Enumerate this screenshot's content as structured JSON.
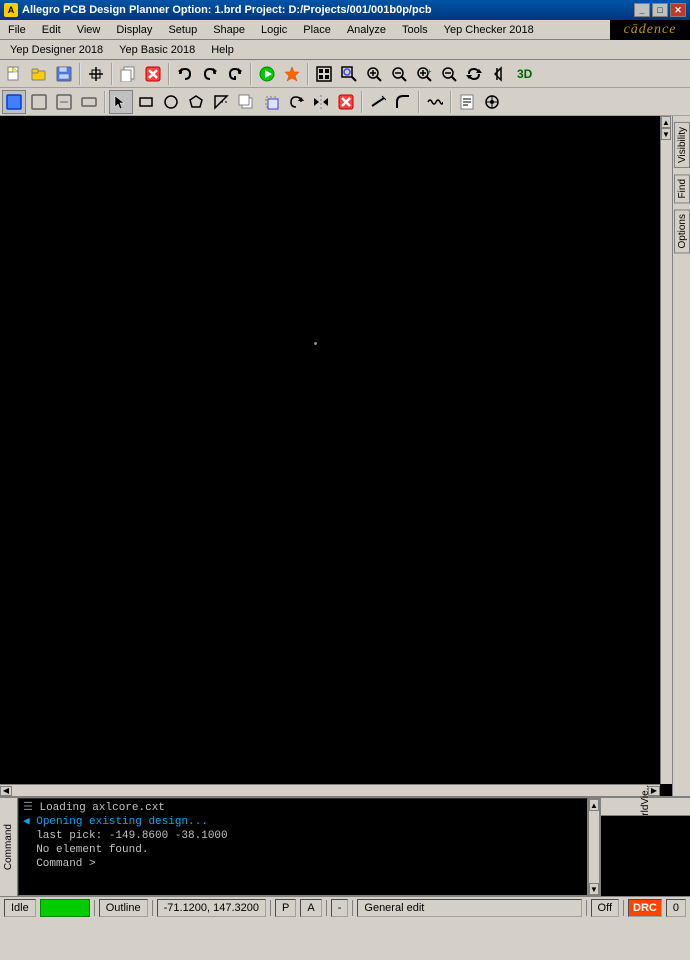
{
  "titlebar": {
    "title": "Allegro PCB Design Planner Option: 1.brd  Project: D:/Projects/001/001b0p/pcb",
    "icon": "A"
  },
  "menubar1": {
    "items": [
      "File",
      "Edit",
      "View",
      "Display",
      "Setup",
      "Shape",
      "Logic",
      "Place",
      "Analyze",
      "Tools",
      "Yep Checker 2018"
    ]
  },
  "menubar2": {
    "items": [
      "Yep Designer 2018",
      "Yep Basic 2018",
      "Help"
    ]
  },
  "cadence_logo": "cādence",
  "right_panel": {
    "tabs": [
      "Visibility",
      "Find",
      "Options"
    ]
  },
  "console": {
    "lines": [
      {
        "type": "icon",
        "text": "Loading axlcore.cxt"
      },
      {
        "type": "arrow",
        "text": "Opening existing design..."
      },
      {
        "type": "normal",
        "text": "last pick:  -149.8600 -38.1000"
      },
      {
        "type": "normal",
        "text": "No element found."
      },
      {
        "type": "normal",
        "text": "Command >"
      }
    ],
    "label": "Command"
  },
  "worldview": {
    "label": "WorldVie..."
  },
  "statusbar": {
    "mode": "Idle",
    "green_indicator": "",
    "outline": "Outline",
    "coords": "-71.1200, 147.3200",
    "p_label": "P",
    "a_label": "A",
    "dash": "-",
    "general_edit": "General edit",
    "off": "Off",
    "drc": "DRC",
    "count": "0"
  },
  "toolbar1_buttons": [
    {
      "name": "open",
      "icon": "📂",
      "tooltip": "Open"
    },
    {
      "name": "open2",
      "icon": "📁",
      "tooltip": "Open project"
    },
    {
      "name": "save",
      "icon": "💾",
      "tooltip": "Save"
    },
    {
      "name": "crosshair",
      "icon": "✛",
      "tooltip": "Crosshair"
    },
    {
      "name": "cut",
      "icon": "✂",
      "tooltip": "Cut"
    },
    {
      "name": "undo",
      "icon": "↩",
      "tooltip": "Undo"
    },
    {
      "name": "redo",
      "icon": "↪",
      "tooltip": "Redo"
    },
    {
      "name": "redo2",
      "icon": "⟳",
      "tooltip": "Redo"
    },
    {
      "name": "green-dot",
      "icon": "🔵",
      "tooltip": "Run"
    },
    {
      "name": "pin",
      "icon": "📌",
      "tooltip": "Pin"
    },
    {
      "name": "sep1",
      "icon": "",
      "tooltip": ""
    },
    {
      "name": "fit",
      "icon": "⊞",
      "tooltip": "Fit"
    },
    {
      "name": "zoom-area",
      "icon": "⊡",
      "tooltip": "Zoom area"
    },
    {
      "name": "zoom-in",
      "icon": "🔍",
      "tooltip": "Zoom in"
    },
    {
      "name": "zoom-out",
      "icon": "🔎",
      "tooltip": "Zoom out"
    },
    {
      "name": "zoom-in2",
      "icon": "+🔍",
      "tooltip": "Zoom in"
    },
    {
      "name": "zoom-out2",
      "icon": "-🔍",
      "tooltip": "Zoom out"
    },
    {
      "name": "refresh",
      "icon": "↻",
      "tooltip": "Refresh"
    },
    {
      "name": "prev-view",
      "icon": "◁",
      "tooltip": "Previous view"
    },
    {
      "name": "3d",
      "icon": "3D",
      "tooltip": "3D view"
    }
  ],
  "toolbar2_buttons": [
    {
      "name": "select-active",
      "icon": "▣",
      "tooltip": "Select",
      "active": true
    },
    {
      "name": "select",
      "icon": "□",
      "tooltip": "Select"
    },
    {
      "name": "select2",
      "icon": "◻",
      "tooltip": "Select2"
    },
    {
      "name": "select3",
      "icon": "▭",
      "tooltip": "Select3"
    },
    {
      "name": "cursor",
      "icon": "↖",
      "tooltip": "Cursor",
      "active": true
    },
    {
      "name": "rectangle",
      "icon": "▬",
      "tooltip": "Rectangle"
    },
    {
      "name": "circle",
      "icon": "○",
      "tooltip": "Circle"
    },
    {
      "name": "poly",
      "icon": "⬠",
      "tooltip": "Polygon"
    },
    {
      "name": "snap",
      "icon": "↗",
      "tooltip": "Snap"
    },
    {
      "name": "copy",
      "icon": "⊞",
      "tooltip": "Copy"
    },
    {
      "name": "move",
      "icon": "⤡",
      "tooltip": "Move"
    },
    {
      "name": "rotate",
      "icon": "⟳",
      "tooltip": "Rotate"
    },
    {
      "name": "mirror",
      "icon": "⊡",
      "tooltip": "Mirror"
    },
    {
      "name": "delete",
      "icon": "✕",
      "tooltip": "Delete"
    },
    {
      "name": "sep2",
      "icon": "",
      "tooltip": ""
    },
    {
      "name": "route1",
      "icon": "→",
      "tooltip": "Route"
    },
    {
      "name": "route2",
      "icon": "↗",
      "tooltip": "Route2"
    },
    {
      "name": "sep3",
      "icon": "",
      "tooltip": ""
    },
    {
      "name": "wave",
      "icon": "〜",
      "tooltip": "Wave"
    },
    {
      "name": "sep4",
      "icon": "",
      "tooltip": ""
    },
    {
      "name": "report",
      "icon": "📋",
      "tooltip": "Report"
    },
    {
      "name": "drill",
      "icon": "⊙",
      "tooltip": "Drill"
    }
  ]
}
